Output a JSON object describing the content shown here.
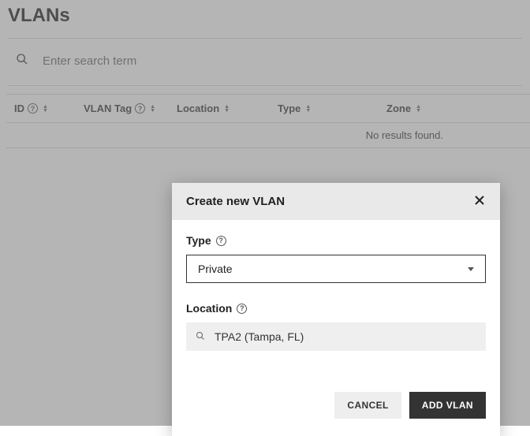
{
  "page": {
    "title": "VLANs"
  },
  "search": {
    "placeholder": "Enter search term"
  },
  "table": {
    "headers": {
      "id": "ID",
      "tag": "VLAN Tag",
      "location": "Location",
      "type": "Type",
      "zone": "Zone"
    },
    "empty_text": "No results found."
  },
  "modal": {
    "title": "Create new VLAN",
    "type_label": "Type",
    "type_value": "Private",
    "location_label": "Location",
    "location_value": "TPA2 (Tampa, FL)",
    "cancel_label": "CANCEL",
    "submit_label": "ADD VLAN"
  }
}
